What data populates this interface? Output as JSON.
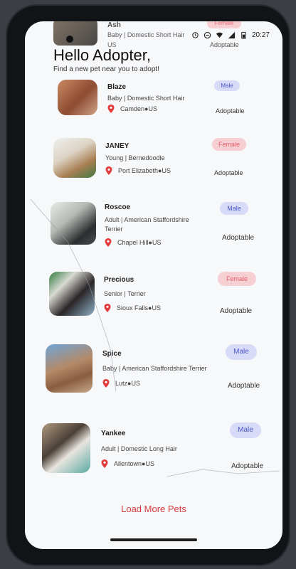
{
  "status_bar": {
    "time": "20:27",
    "icons": [
      "alarm-icon",
      "no-disturb-icon",
      "wifi-icon",
      "signal-icon",
      "battery-icon"
    ]
  },
  "peek_card": {
    "name": "Ash",
    "breed": "Baby | Domestic Short Hair",
    "location": "US",
    "gender": "Female",
    "status": "Adoptable"
  },
  "header": {
    "title": "Hello Adopter,",
    "subtitle": "Find a new pet near you to adopt!"
  },
  "pets": [
    {
      "name": "Blaze",
      "breed": "Baby | Domestic Short Hair",
      "location": "Camden●US",
      "gender": "Male",
      "status": "Adoptable"
    },
    {
      "name": "JANEY",
      "breed": "Young | Bernedoodle",
      "location": "Port Elizabeth●US",
      "gender": "Female",
      "status": "Adoptable"
    },
    {
      "name": "Roscoe",
      "breed": "Adult | American Staffordshire",
      "breed_line2": "Terrier",
      "location": "Chapel Hill●US",
      "gender": "Male",
      "status": "Adoptable"
    },
    {
      "name": "Precious",
      "breed": "Senior | Terrier",
      "location": "Sioux Falls●US",
      "gender": "Female",
      "status": "Adoptable"
    },
    {
      "name": "Spice",
      "breed": "Baby | American Staffordshire Terrier",
      "location": "Lutz●US",
      "gender": "Male",
      "status": "Adoptable"
    },
    {
      "name": "Yankee",
      "breed": "Adult | Domestic Long Hair",
      "location": "Allentown●US",
      "gender": "Male",
      "status": "Adoptable"
    }
  ],
  "load_more_label": "Load More Pets",
  "colors": {
    "male_bg": "#d8dbf7",
    "male_text": "#4b56c8",
    "female_bg": "#f6cfd3",
    "female_text": "#e25b68",
    "pin": "#e23b3b",
    "accent": "#d33b3b"
  }
}
